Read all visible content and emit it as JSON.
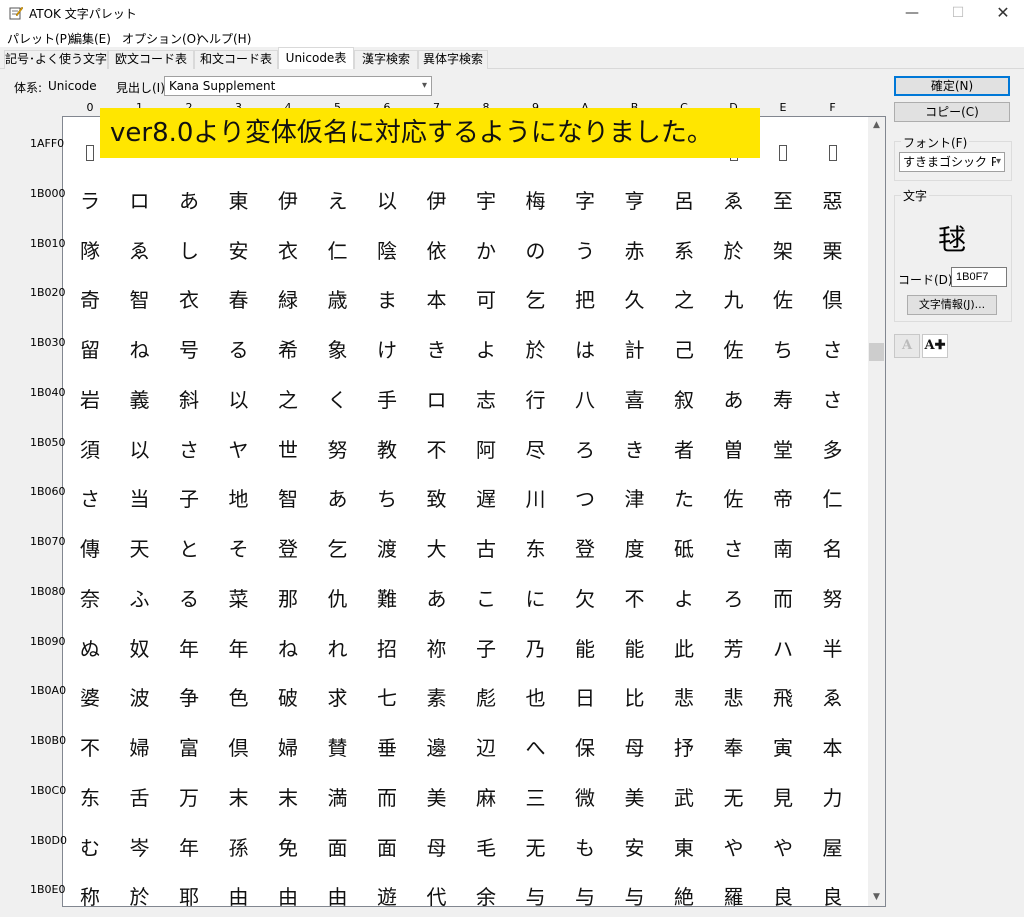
{
  "window": {
    "title": "ATOK 文字パレット",
    "min_glyph": "—",
    "max_glyph": "☐",
    "close_glyph": "✕"
  },
  "menu": [
    "パレット(P)",
    "編集(E)",
    "オプション(O)",
    "ヘルプ(H)"
  ],
  "tabs": [
    {
      "label": "記号･よく使う文字",
      "active": false
    },
    {
      "label": "欧文コード表",
      "active": false
    },
    {
      "label": "和文コード表",
      "active": false
    },
    {
      "label": "Unicode表",
      "active": true
    },
    {
      "label": "漢字検索",
      "active": false
    },
    {
      "label": "異体字検索",
      "active": false
    }
  ],
  "toolbar": {
    "system_label": "体系:",
    "system_value": "Unicode",
    "heading_label": "見出し(I)",
    "heading_value": "Kana Supplement"
  },
  "columns": [
    "0",
    "1",
    "2",
    "3",
    "4",
    "5",
    "6",
    "7",
    "8",
    "9",
    "A",
    "B",
    "C",
    "D",
    "E",
    "F"
  ],
  "banner": "ver8.0より変体仮名に対応するようになりました。",
  "rows": [
    {
      "label": "1AFF0",
      "chars": [
        "",
        "",
        "",
        "",
        "",
        "",
        "",
        "",
        "",
        "",
        "",
        "",
        "",
        "",
        "",
        ""
      ]
    },
    {
      "label": "1B000",
      "chars": [
        "ラ",
        "ロ",
        "あ",
        "東",
        "伊",
        "え",
        "以",
        "伊",
        "宇",
        "梅",
        "字",
        "亨",
        "呂",
        "ゑ",
        "至",
        "惡"
      ]
    },
    {
      "label": "1B010",
      "chars": [
        "隊",
        "ゑ",
        "し",
        "安",
        "衣",
        "仁",
        "陰",
        "依",
        "か",
        "の",
        "う",
        "赤",
        "系",
        "於",
        "架",
        "栗"
      ]
    },
    {
      "label": "1B020",
      "chars": [
        "奇",
        "智",
        "衣",
        "春",
        "緑",
        "歳",
        "ま",
        "本",
        "可",
        "乞",
        "把",
        "久",
        "之",
        "九",
        "佐",
        "倶"
      ]
    },
    {
      "label": "1B030",
      "chars": [
        "留",
        "ね",
        "号",
        "る",
        "希",
        "象",
        "け",
        "き",
        "よ",
        "於",
        "は",
        "計",
        "己",
        "佐",
        "ち",
        "さ"
      ]
    },
    {
      "label": "1B040",
      "chars": [
        "岩",
        "義",
        "斜",
        "以",
        "之",
        "く",
        "手",
        "ロ",
        "志",
        "行",
        "八",
        "喜",
        "叙",
        "あ",
        "寿",
        "さ"
      ]
    },
    {
      "label": "1B050",
      "chars": [
        "須",
        "以",
        "さ",
        "ヤ",
        "世",
        "努",
        "教",
        "不",
        "阿",
        "尽",
        "ろ",
        "き",
        "者",
        "曽",
        "堂",
        "多"
      ]
    },
    {
      "label": "1B060",
      "chars": [
        "さ",
        "当",
        "子",
        "地",
        "智",
        "あ",
        "ち",
        "致",
        "遅",
        "川",
        "つ",
        "津",
        "た",
        "佐",
        "帝",
        "仁"
      ]
    },
    {
      "label": "1B070",
      "chars": [
        "傳",
        "天",
        "と",
        "そ",
        "登",
        "乞",
        "渡",
        "大",
        "古",
        "东",
        "登",
        "度",
        "砥",
        "さ",
        "南",
        "名"
      ]
    },
    {
      "label": "1B080",
      "chars": [
        "奈",
        "ふ",
        "る",
        "菜",
        "那",
        "仇",
        "難",
        "あ",
        "こ",
        "に",
        "欠",
        "不",
        "よ",
        "ろ",
        "而",
        "努"
      ]
    },
    {
      "label": "1B090",
      "chars": [
        "ぬ",
        "奴",
        "年",
        "年",
        "ね",
        "れ",
        "招",
        "祢",
        "子",
        "乃",
        "能",
        "能",
        "此",
        "芳",
        "ハ",
        "半"
      ]
    },
    {
      "label": "1B0A0",
      "chars": [
        "婆",
        "波",
        "争",
        "色",
        "破",
        "求",
        "七",
        "素",
        "彪",
        "也",
        "日",
        "比",
        "悲",
        "悲",
        "飛",
        "ゑ"
      ]
    },
    {
      "label": "1B0B0",
      "chars": [
        "不",
        "婦",
        "富",
        "倶",
        "婦",
        "賛",
        "垂",
        "邊",
        "辺",
        "へ",
        "保",
        "母",
        "抒",
        "奉",
        "寅",
        "本"
      ]
    },
    {
      "label": "1B0C0",
      "chars": [
        "东",
        "舌",
        "万",
        "末",
        "末",
        "満",
        "而",
        "美",
        "麻",
        "三",
        "微",
        "美",
        "武",
        "无",
        "見",
        "力"
      ]
    },
    {
      "label": "1B0D0",
      "chars": [
        "む",
        "岑",
        "年",
        "孫",
        "免",
        "面",
        "面",
        "母",
        "毛",
        "无",
        "も",
        "安",
        "東",
        "や",
        "や",
        "屋"
      ]
    },
    {
      "label": "1B0E0",
      "chars": [
        "称",
        "於",
        "耶",
        "由",
        "由",
        "由",
        "遊",
        "代",
        "余",
        "与",
        "与",
        "与",
        "絶",
        "羅",
        "良",
        "良"
      ]
    }
  ],
  "buttons": {
    "confirm": "確定(N)",
    "copy": "コピー(C)",
    "char_info": "文字情報(J)..."
  },
  "font_group": {
    "label": "フォント(F)",
    "value": "すきまゴシック P"
  },
  "char_group": {
    "label": "文字",
    "preview": "毬",
    "code_label": "コード(D)",
    "code_value": "1B0F7"
  },
  "small_buttons": {
    "shrink_glyph": "A",
    "grow_glyph": "A✚"
  },
  "colors": {
    "banner": "#ffe600",
    "default_button_border": "#0078d7"
  }
}
